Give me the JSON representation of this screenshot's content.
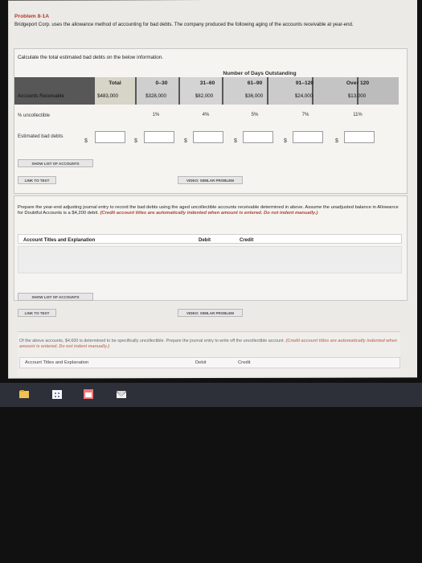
{
  "problem_title": "Problem 8-1A",
  "intro": "Bridgeport Corp. uses the allowance method of accounting for bad debts. The company produced the following aging of the accounts receivable at year-end.",
  "calculate_label": "Calculate the total estimated bad debts on the below information.",
  "aging_header": "Number of Days Outstanding",
  "columns": [
    "Total",
    "0–30",
    "31–60",
    "61–90",
    "91–120",
    "Over 120"
  ],
  "accounts_receivable": {
    "label": "Accounts Receivable",
    "values": [
      "$483,000",
      "$328,000",
      "$82,000",
      "$36,000",
      "$24,000",
      "$13,000"
    ]
  },
  "uncollectible": {
    "label": "% uncollectible",
    "values": [
      "1%",
      "4%",
      "5%",
      "7%",
      "11%"
    ]
  },
  "estimated": {
    "label": "Estimated bad debts",
    "dollar": "$"
  },
  "buttons": {
    "show_list_1": "SHOW LIST OF ACCOUNTS",
    "link_to_text_1": "LINK TO TEXT",
    "video_1": "VIDEO: SIMILAR PROBLEM",
    "show_list_2": "SHOW LIST OF ACCOUNTS",
    "link_to_text_2": "LINK TO TEXT",
    "video_2": "VIDEO: SIMILAR PROBLEM"
  },
  "prepare_text": "Prepare the year-end adjusting journal entry to record the bad debts using the aged uncollectible accounts receivable determined in above. Assume the unadjusted balance in Allowance for Doubtful Accounts is a $4,200 debit. ",
  "prepare_red": "(Credit account titles are automatically indented when amount is entered. Do not indent manually.)",
  "journal": {
    "title": "Account Titles and Explanation",
    "debit": "Debit",
    "credit": "Credit"
  },
  "lower_text": "Of the above accounts, $4,600 is determined to be specifically uncollectible. Prepare the journal entry to write off the uncollectible account. ",
  "lower_red": "(Credit account titles are automatically indented when amount is entered. Do not indent manually.)",
  "journal2": {
    "title": "Account Titles and Explanation",
    "debit": "Debit",
    "credit": "Credit"
  },
  "colors": {
    "accent_red": "#b33b2c",
    "table_dark": "#575757",
    "taskbar": "#2d3038"
  },
  "taskbar_icons": [
    "file-explorer-icon",
    "store-icon",
    "calendar-icon",
    "mail-icon"
  ]
}
